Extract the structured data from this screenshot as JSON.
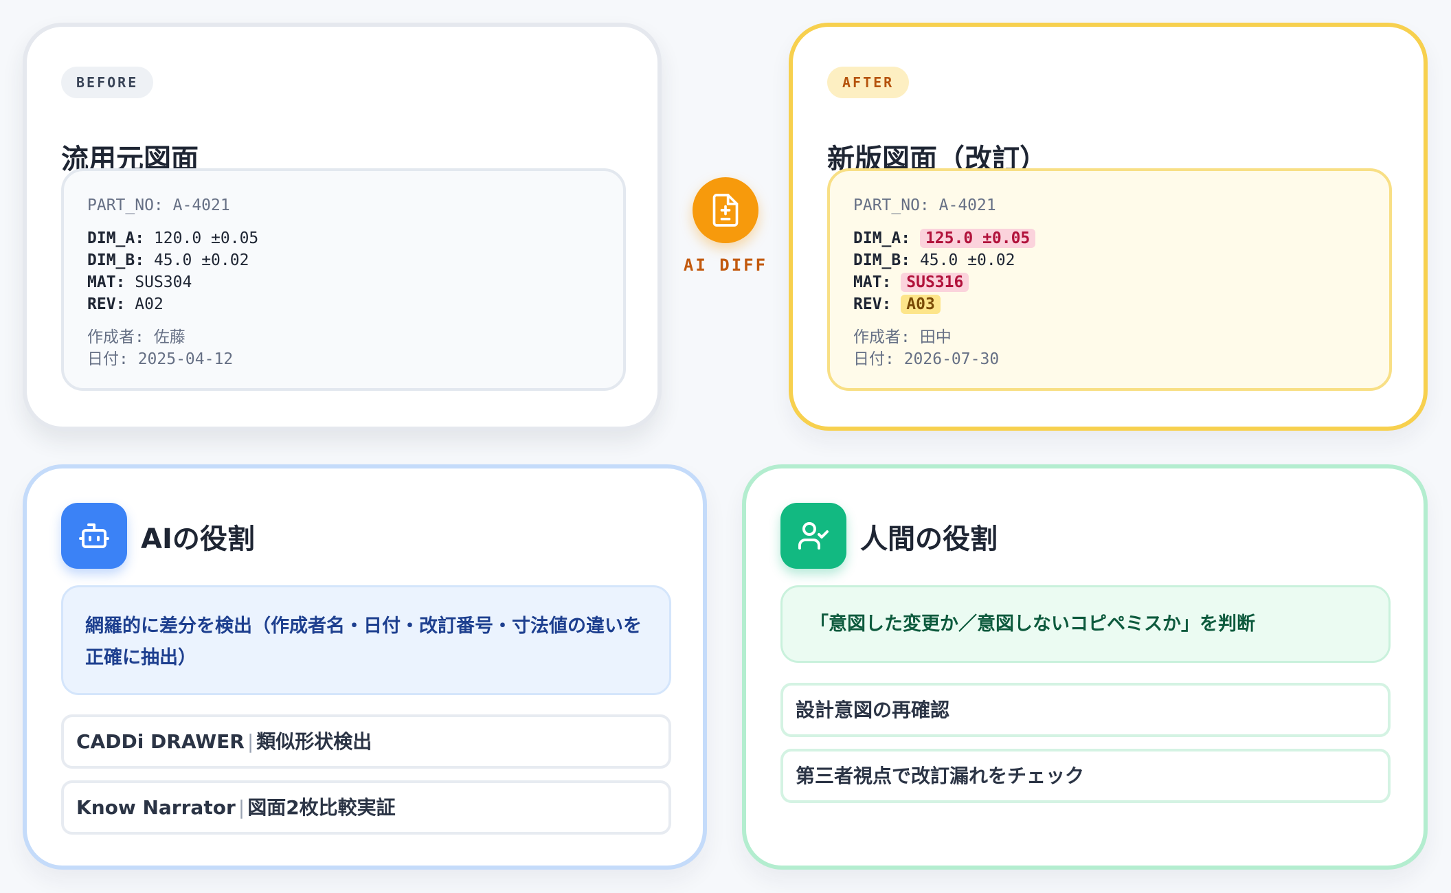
{
  "before": {
    "badge": "BEFORE",
    "title": "流用元図面",
    "doc": {
      "part_no": "PART_NO: A-4021",
      "dim_a_key": "DIM_A:",
      "dim_a_val": "120.0 ±0.05",
      "dim_b_key": "DIM_B:",
      "dim_b_val": "45.0 ±0.02",
      "mat_key": "MAT:",
      "mat_val": "SUS304",
      "rev_key": "REV:",
      "rev_val": "A02",
      "author": "作成者: 佐藤",
      "date": "日付: 2025-04-12"
    }
  },
  "after": {
    "badge": "AFTER",
    "title": "新版図面（改訂）",
    "doc": {
      "part_no": "PART_NO: A-4021",
      "dim_a_key": "DIM_A:",
      "dim_a_val": "125.0 ±0.05",
      "dim_b_key": "DIM_B:",
      "dim_b_val": "45.0 ±0.02",
      "mat_key": "MAT:",
      "mat_val": "SUS316",
      "rev_key": "REV:",
      "rev_val": "A03",
      "author": "作成者: 田中",
      "date": "日付: 2026-07-30"
    }
  },
  "diff": {
    "label": "AI DIFF",
    "icon": "file-diff-icon"
  },
  "ai_role": {
    "icon": "robot-icon",
    "title": "AIの役割",
    "highlight": "網羅的に差分を検出（作成者名・日付・改訂番号・寸法値の違いを正確に抽出）",
    "items": [
      {
        "name": "CADDi DRAWER",
        "desc": "類似形状検出"
      },
      {
        "name": "Know Narrator",
        "desc": "図面2枚比較実証"
      }
    ]
  },
  "human_role": {
    "icon": "user-check-icon",
    "title": "人間の役割",
    "highlight": "「意図した変更か／意図しないコピペミスか」を判断",
    "items": [
      {
        "text": "設計意図の再確認"
      },
      {
        "text": "第三者視点で改訂漏れをチェック"
      }
    ]
  },
  "colors": {
    "accent_orange": "#f79a0c",
    "ai_blue": "#3b82f6",
    "human_green": "#12b981",
    "after_border": "#f7d04e",
    "diff_red": "#b1123b"
  }
}
